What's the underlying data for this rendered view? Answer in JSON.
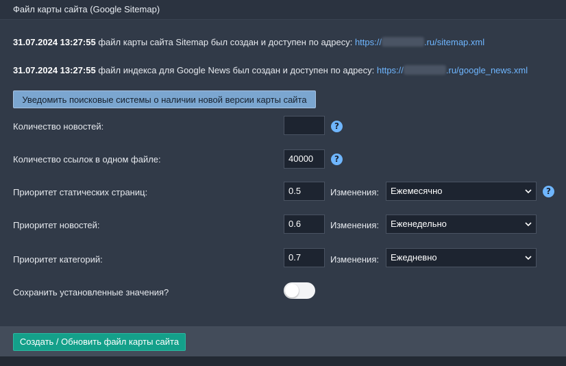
{
  "header": {
    "title": "Файл карты сайта (Google Sitemap)"
  },
  "info": [
    {
      "date": "31.07.2024 13:27:55",
      "text": " файл карты сайта Sitemap был создан и доступен по адресу: ",
      "link_prefix": "https://",
      "link_suffix": ".ru/sitemap.xml"
    },
    {
      "date": "31.07.2024 13:27:55",
      "text": " файл индекса для Google News был создан и доступен по адресу: ",
      "link_prefix": "https://",
      "link_suffix": ".ru/google_news.xml"
    }
  ],
  "notify_button": "Уведомить поисковые системы о наличии новой версии карты сайта",
  "fields": {
    "news_count": {
      "label": "Количество новостей:",
      "value": ""
    },
    "links_per_file": {
      "label": "Количество ссылок в одном файле:",
      "value": "40000"
    },
    "static_priority": {
      "label": "Приоритет статических страниц:",
      "value": "0.5",
      "changes_label": "Изменения:",
      "changes_value": "Ежемесячно"
    },
    "news_priority": {
      "label": "Приоритет новостей:",
      "value": "0.6",
      "changes_label": "Изменения:",
      "changes_value": "Еженедельно"
    },
    "category_priority": {
      "label": "Приоритет категорий:",
      "value": "0.7",
      "changes_label": "Изменения:",
      "changes_value": "Ежедневно"
    },
    "save_values": {
      "label": "Сохранить установленные значения?",
      "checked": false
    }
  },
  "help_icon_char": "?",
  "create_button": "Создать / Обновить файл карты сайта",
  "colors": {
    "link": "#6fb6ff",
    "primary_button": "#14a08a",
    "notify_button": "#7ba6d0",
    "background": "#313a48"
  }
}
